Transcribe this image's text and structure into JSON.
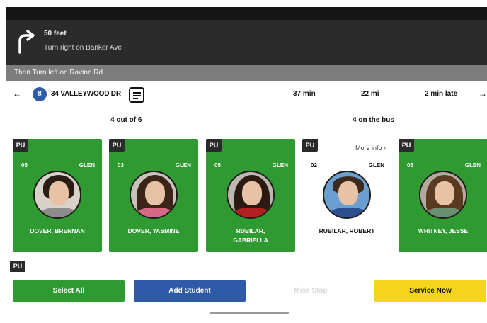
{
  "navigation": {
    "turn_icon": "turn-right-arrow-icon",
    "distance": "50 feet",
    "instruction": "Turn right on Banker Ave",
    "then_instruction": "Then Turn left on Ravine Rd"
  },
  "stop": {
    "number": "8",
    "address": "34 VALLEYWOOD DR",
    "eta": "37 min",
    "miles": "22 mi",
    "status": "2 min late"
  },
  "counts": {
    "picked": "4 out of 6",
    "on_bus": "4 on the bus"
  },
  "students": [
    {
      "tag": "PU",
      "num": "05",
      "school": "GLEN",
      "name": "DOVER, BRENNAN",
      "status": "picked-up"
    },
    {
      "tag": "PU",
      "num": "03",
      "school": "GLEN",
      "name": "DOVER, YASMINE",
      "status": "picked-up"
    },
    {
      "tag": "PU",
      "num": "05",
      "school": "GLEN",
      "name": "RUBILAR, GABRIELLA",
      "status": "picked-up"
    },
    {
      "tag": "PU",
      "num": "02",
      "school": "GLEN",
      "name": "RUBILAR, ROBERT",
      "status": "pending",
      "more_info": "More info ›"
    },
    {
      "tag": "PU",
      "num": "05",
      "school": "GLEN",
      "name": "WHITNEY, JESSE",
      "status": "picked-up"
    }
  ],
  "next_row_tag": "PU",
  "actions": {
    "select_all": "Select All",
    "add_student": "Add Student",
    "disabled": "Miss Stop",
    "service_now": "Service Now"
  },
  "colors": {
    "picked_green": "#2f9a31",
    "blue": "#2f5aa8",
    "yellow": "#f4d51b",
    "nav_dark": "#2b2b2b"
  }
}
